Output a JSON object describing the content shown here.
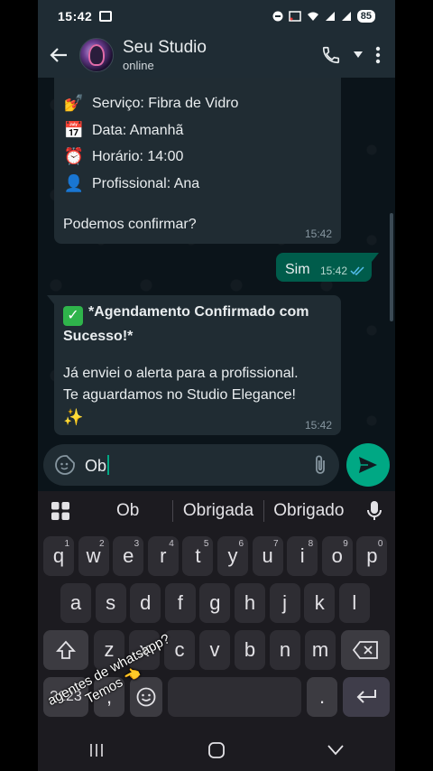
{
  "status_bar": {
    "time": "15:42",
    "battery": "85",
    "icons": [
      "screen-record-icon",
      "dnd-icon",
      "cast-icon",
      "wifi-icon",
      "signal-icon",
      "signal-icon",
      "battery-icon"
    ]
  },
  "header": {
    "contact_name": "Seu Studio",
    "presence": "online"
  },
  "messages": [
    {
      "direction": "incoming",
      "lines": [
        {
          "emoji": "💅",
          "text": "Serviço: Fibra de Vidro"
        },
        {
          "emoji": "📅",
          "text": "Data: Amanhã"
        },
        {
          "emoji": "⏰",
          "text": "Horário: 14:00"
        },
        {
          "emoji": "👤",
          "text": "Profissional: Ana"
        }
      ],
      "question": "Podemos confirmar?",
      "time": "15:42"
    },
    {
      "direction": "outgoing",
      "text": "Sim",
      "time": "15:42",
      "status": "read"
    },
    {
      "direction": "incoming",
      "title": "*Agendamento Confirmado com Sucesso!*",
      "line1": "Já enviei o alerta para a profissional.",
      "line2": "Te aguardamos no Studio Elegance!",
      "sparkle": "✨",
      "time": "15:42"
    }
  ],
  "composer": {
    "text": "Ob"
  },
  "keyboard": {
    "suggestions": [
      "Ob",
      "Obrigada",
      "Obrigado"
    ],
    "row1": [
      {
        "k": "q",
        "n": "1"
      },
      {
        "k": "w",
        "n": "2"
      },
      {
        "k": "e",
        "n": "3"
      },
      {
        "k": "r",
        "n": "4"
      },
      {
        "k": "t",
        "n": "5"
      },
      {
        "k": "y",
        "n": "6"
      },
      {
        "k": "u",
        "n": "7"
      },
      {
        "k": "i",
        "n": "8"
      },
      {
        "k": "o",
        "n": "9"
      },
      {
        "k": "p",
        "n": "0"
      }
    ],
    "row2": [
      "a",
      "s",
      "d",
      "f",
      "g",
      "h",
      "j",
      "k",
      "l"
    ],
    "row3": [
      "z",
      "x",
      "c",
      "v",
      "b",
      "n",
      "m"
    ],
    "symbols_key": "?123",
    "comma_key": ",",
    "period_key": "."
  },
  "overlay": {
    "line1": "agentes de whatsapp?",
    "line2": "Temos 👈"
  }
}
